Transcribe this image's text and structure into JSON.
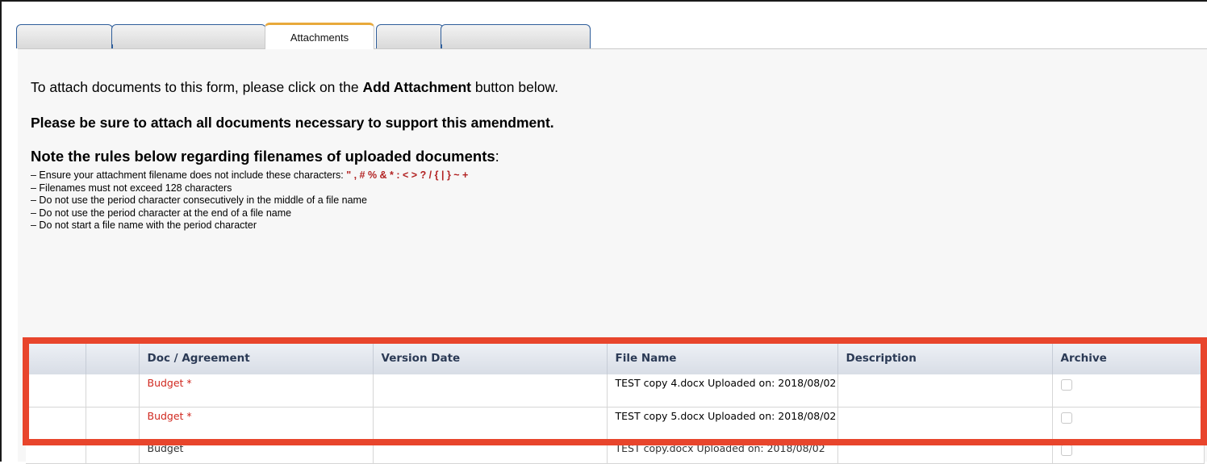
{
  "tabs": {
    "active_label": "Attachments"
  },
  "intro": {
    "prefix": "To attach documents to this form, please click on the ",
    "button_ref": "Add Attachment",
    "suffix": " button below."
  },
  "notice": "Please be sure to attach all documents necessary to support this amendment.",
  "note_title": "Note the rules below regarding filenames of uploaded documents",
  "note_colon": ":",
  "rules": {
    "r1_prefix": "– Ensure your attachment filename does not include these characters: ",
    "r1_chars": "\" , # % & * : < > ? / { | } ~ +",
    "r2": "– Filenames must not exceed 128 characters",
    "r3": "– Do not use the period character consecutively in the middle of a file name",
    "r4": "– Do not use the period character at the end of a file name",
    "r5": "– Do not start a file name with the period character"
  },
  "table": {
    "headers": {
      "doc": "Doc / Agreement",
      "version": "Version Date",
      "file": "File Name",
      "desc": "Description",
      "archive": "Archive"
    },
    "rows": [
      {
        "doc": "Budget *",
        "version": "",
        "file": "TEST copy 4.docx Uploaded on: 2018/08/02",
        "desc": ""
      },
      {
        "doc": "Budget *",
        "version": "",
        "file": "TEST copy 5.docx Uploaded on: 2018/08/02",
        "desc": ""
      },
      {
        "doc": "Budget",
        "version": "",
        "file": "TEST copy.docx Uploaded on: 2018/08/02",
        "desc": ""
      }
    ]
  },
  "colors": {
    "highlight": "#e8452c",
    "required_doc": "#d0281f",
    "active_tab_accent": "#e8a93b"
  }
}
